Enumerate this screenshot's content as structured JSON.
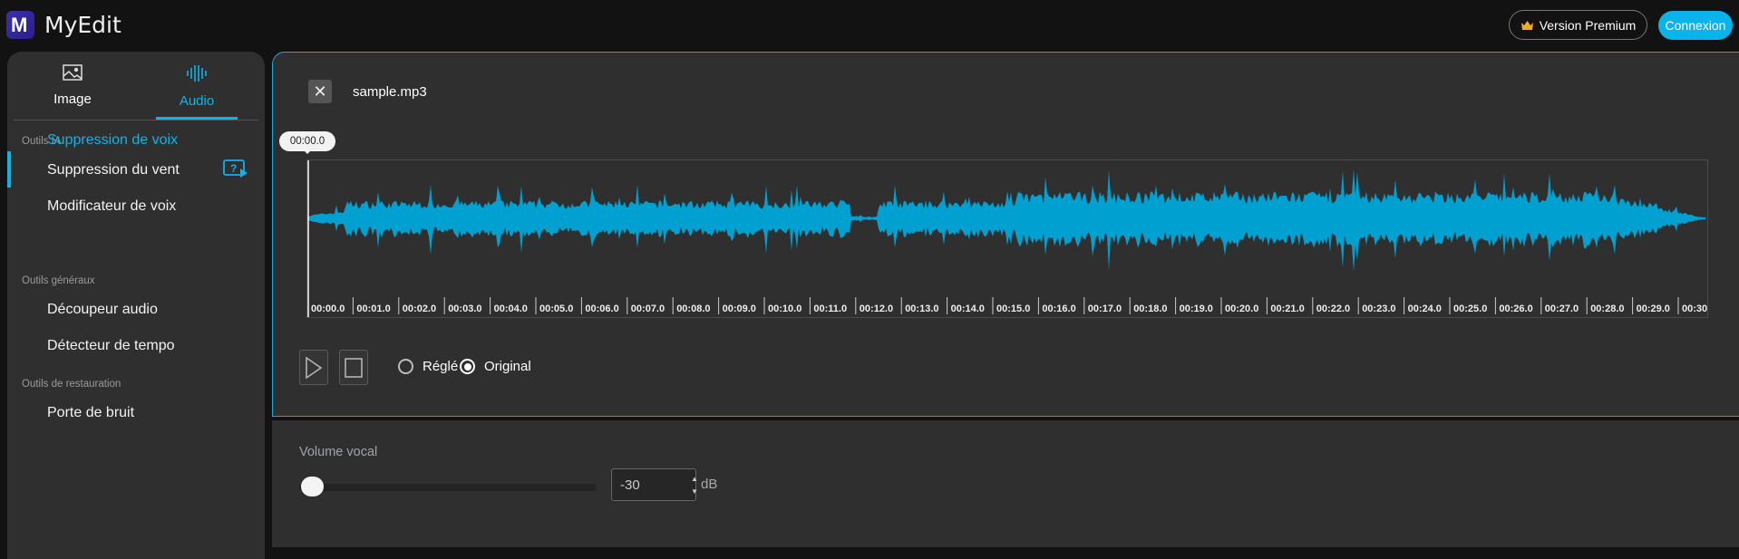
{
  "header": {
    "brand": "MyEdit",
    "logo_letter": "M",
    "premium_label": "Version Premium",
    "login_label": "Connexion"
  },
  "sidebar": {
    "tabs": [
      {
        "label": "Image",
        "icon": "image-icon",
        "active": false
      },
      {
        "label": "Audio",
        "icon": "audio-wave-icon",
        "active": true
      }
    ],
    "sections": [
      {
        "title": "Outils IA",
        "items": [
          {
            "label": "Suppression de voix",
            "active": true
          },
          {
            "label": "Suppression du vent"
          },
          {
            "label": "Modificateur de voix"
          }
        ]
      },
      {
        "title": "Outils généraux",
        "items": [
          {
            "label": "Découpeur audio"
          },
          {
            "label": "Détecteur de tempo"
          }
        ]
      },
      {
        "title": "Outils de restauration",
        "items": [
          {
            "label": "Porte de bruit"
          }
        ]
      }
    ]
  },
  "player": {
    "file_name": "sample.mp3",
    "playhead_time": "00:00.0",
    "time_labels": [
      "00:00.0",
      "00:01.0",
      "00:02.0",
      "00:03.0",
      "00:04.0",
      "00:05.0",
      "00:06.0",
      "00:07.0",
      "00:08.0",
      "00:09.0",
      "00:10.0",
      "00:11.0",
      "00:12.0",
      "00:13.0",
      "00:14.0",
      "00:15.0",
      "00:16.0",
      "00:17.0",
      "00:18.0",
      "00:19.0",
      "00:20.0",
      "00:21.0",
      "00:22.0",
      "00:23.0",
      "00:24.0",
      "00:25.0",
      "00:26.0",
      "00:27.0",
      "00:28.0",
      "00:29.0",
      "00:30"
    ],
    "radio_options": [
      {
        "label": "Réglé",
        "selected": false
      },
      {
        "label": "Original",
        "selected": true
      }
    ],
    "wave_color": "#00a0d0"
  },
  "settings": {
    "volume_label": "Volume vocal",
    "volume_value": "-30",
    "volume_unit": "dB",
    "slider_fraction": 0
  },
  "colors": {
    "accent": "#10b3e8",
    "background": "#121212",
    "panel": "#2f2f2f"
  }
}
